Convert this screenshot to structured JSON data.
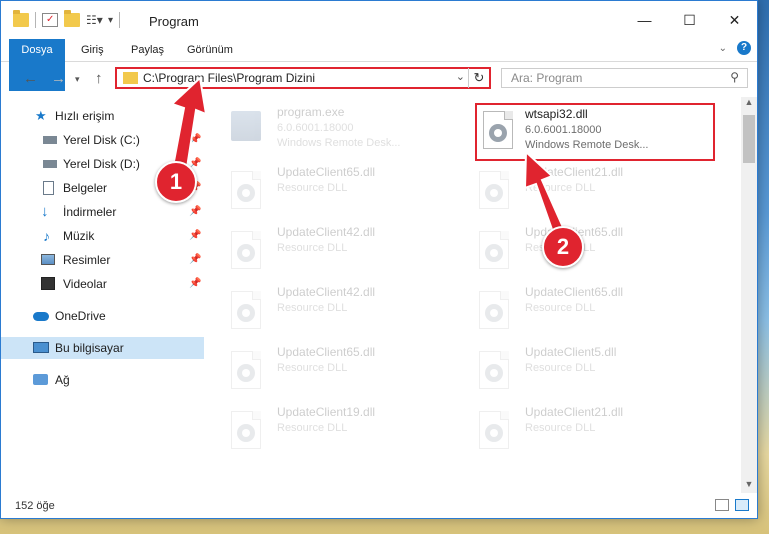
{
  "window": {
    "title": "Program"
  },
  "ribbon": {
    "tabs": [
      "Dosya",
      "Giriş",
      "Paylaş",
      "Görünüm"
    ]
  },
  "navigation": {
    "address": "C:\\Program Files\\Program Dizini",
    "search_placeholder": "Ara: Program"
  },
  "sidebar": {
    "items": [
      {
        "label": "Hızlı erişim",
        "icon": "star-icon"
      },
      {
        "label": "Yerel Disk (C:)",
        "icon": "drive-icon",
        "pinned": true
      },
      {
        "label": "Yerel Disk (D:)",
        "icon": "drive-icon",
        "pinned": true
      },
      {
        "label": "Belgeler",
        "icon": "documents-icon",
        "pinned": true
      },
      {
        "label": "İndirmeler",
        "icon": "download-icon",
        "pinned": true
      },
      {
        "label": "Müzik",
        "icon": "music-icon",
        "pinned": true
      },
      {
        "label": "Resimler",
        "icon": "pictures-icon",
        "pinned": true
      },
      {
        "label": "Videolar",
        "icon": "videos-icon",
        "pinned": true
      },
      {
        "label": "OneDrive",
        "icon": "cloud-icon"
      },
      {
        "label": "Bu bilgisayar",
        "icon": "computer-icon",
        "selected": true
      },
      {
        "label": "Ağ",
        "icon": "network-icon"
      }
    ]
  },
  "files": [
    {
      "name": "program.exe",
      "line1": "6.0.6001.18000",
      "line2": "Windows Remote Desk...",
      "type": "exe",
      "faded": true
    },
    {
      "name": "wtsapi32.dll",
      "line1": "6.0.6001.18000",
      "line2": "Windows Remote Desk...",
      "type": "dll",
      "highlight": true
    },
    {
      "name": "UpdateClient65.dll",
      "line1": "Resource DLL",
      "type": "dll",
      "faded": true
    },
    {
      "name": "UpdateClient21.dll",
      "line1": "Resource DLL",
      "type": "dll",
      "faded": true
    },
    {
      "name": "UpdateClient42.dll",
      "line1": "Resource DLL",
      "type": "dll",
      "faded": true
    },
    {
      "name": "UpdateClient65.dll",
      "line1": "Resource DLL",
      "type": "dll",
      "faded": true
    },
    {
      "name": "UpdateClient42.dll",
      "line1": "Resource DLL",
      "type": "dll",
      "faded": true
    },
    {
      "name": "UpdateClient65.dll",
      "line1": "Resource DLL",
      "type": "dll",
      "faded": true
    },
    {
      "name": "UpdateClient65.dll",
      "line1": "Resource DLL",
      "type": "dll",
      "faded": true
    },
    {
      "name": "UpdateClient5.dll",
      "line1": "Resource DLL",
      "type": "dll",
      "faded": true
    },
    {
      "name": "UpdateClient19.dll",
      "line1": "Resource DLL",
      "type": "dll",
      "faded": true
    },
    {
      "name": "UpdateClient21.dll",
      "line1": "Resource DLL",
      "type": "dll",
      "faded": true
    }
  ],
  "status": {
    "item_count": "152 öğe"
  },
  "annotations": {
    "step1": "1",
    "step2": "2",
    "color": "#e0242f"
  }
}
